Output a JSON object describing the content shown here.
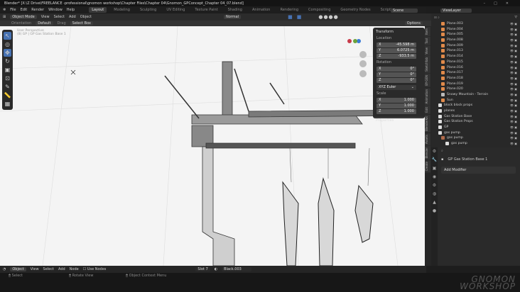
{
  "title": "Blender* [X:\\Z Drive\\FREELANCE -professional\\gnomon workshop\\Chapter Files\\Chapter 04\\Gnomon_GPConcept_Chapter 04_07.blend]",
  "menu": [
    "File",
    "Edit",
    "Render",
    "Window",
    "Help"
  ],
  "workspaces": [
    "Layout",
    "Modeling",
    "Sculpting",
    "UV Editing",
    "Texture Paint",
    "Shading",
    "Animation",
    "Rendering",
    "Compositing",
    "Geometry Nodes",
    "Scripting"
  ],
  "scene": "Scene",
  "view_layer": "ViewLayer",
  "viewport_header": {
    "mode": "Object Mode",
    "items": [
      "View",
      "Select",
      "Add",
      "Object"
    ],
    "pivot": "Normal",
    "options": "Options"
  },
  "tool_settings": {
    "orientation_label": "Orientation",
    "orientation": "Default",
    "drag_label": "Drag",
    "drag": "Select Box"
  },
  "overlay_text": {
    "view": "User Perspective",
    "collection": "(8) GP | GP Gas Station Base 1"
  },
  "transform": {
    "title": "Transform",
    "location_label": "Location",
    "location": [
      [
        "X",
        "-45.598 m"
      ],
      [
        "Y",
        "6.0725 m"
      ],
      [
        "Z",
        "-933.5 m"
      ]
    ],
    "rotation_label": "Rotation",
    "rotation": [
      [
        "X",
        "0°"
      ],
      [
        "Y",
        "0°"
      ],
      [
        "Z",
        "0°"
      ]
    ],
    "rotation_mode": "XYZ Euler",
    "scale_label": "Scale",
    "scale": [
      [
        "X",
        "1.000"
      ],
      [
        "Y",
        "1.000"
      ],
      [
        "Z",
        "1.000"
      ]
    ],
    "properties": "Properties"
  },
  "side_tabs": [
    "Item",
    "Tool",
    "View",
    "Sketchfab",
    "BY-GEN",
    "Animation",
    "Edit",
    "BlenderKit",
    "Assets",
    "Blender",
    "Create"
  ],
  "outliner": [
    {
      "name": "Plane.003",
      "type": "mesh"
    },
    {
      "name": "Plane.004",
      "type": "mesh"
    },
    {
      "name": "Plane.005",
      "type": "mesh"
    },
    {
      "name": "Plane.008",
      "type": "mesh"
    },
    {
      "name": "Plane.009",
      "type": "mesh"
    },
    {
      "name": "Plane.013",
      "type": "mesh"
    },
    {
      "name": "Plane.014",
      "type": "mesh"
    },
    {
      "name": "Plane.015",
      "type": "mesh"
    },
    {
      "name": "Plane.016",
      "type": "mesh"
    },
    {
      "name": "Plane.017",
      "type": "mesh"
    },
    {
      "name": "Plane.018",
      "type": "mesh"
    },
    {
      "name": "Plane.019",
      "type": "mesh"
    },
    {
      "name": "Plane.020",
      "type": "mesh"
    },
    {
      "name": "Snowy Mountain - Terrain",
      "type": "empty"
    },
    {
      "name": "Sun",
      "type": "light"
    },
    {
      "name": "block block props",
      "type": "collection"
    },
    {
      "name": "planes",
      "type": "collection"
    },
    {
      "name": "Gas Station Base",
      "type": "collection"
    },
    {
      "name": "Gas Station Props",
      "type": "collection"
    },
    {
      "name": "GP",
      "type": "collection"
    },
    {
      "name": "gas pump",
      "type": "collection"
    },
    {
      "name": "gas pump",
      "type": "gp"
    },
    {
      "name": "gas pump",
      "type": "gpdata"
    }
  ],
  "properties": {
    "object": "GP Gas Station Base 1",
    "add_modifier": "Add Modifier"
  },
  "node_header": {
    "type": "Object",
    "items": [
      "View",
      "Select",
      "Add",
      "Node"
    ],
    "use_nodes": "Use Nodes",
    "slot": "Slot 7",
    "material": "Black.003"
  },
  "status": {
    "select": "Select",
    "rotate": "Rotate View",
    "context": "Object Context Menu"
  },
  "watermark": [
    "GNOMON",
    "WORKSHOP"
  ],
  "colors": {
    "accent": "#4772b3",
    "viewport_bg": "#f4f4f4",
    "mesh_icon": "#e08a4a",
    "data_icon": "#3fbf6f"
  }
}
